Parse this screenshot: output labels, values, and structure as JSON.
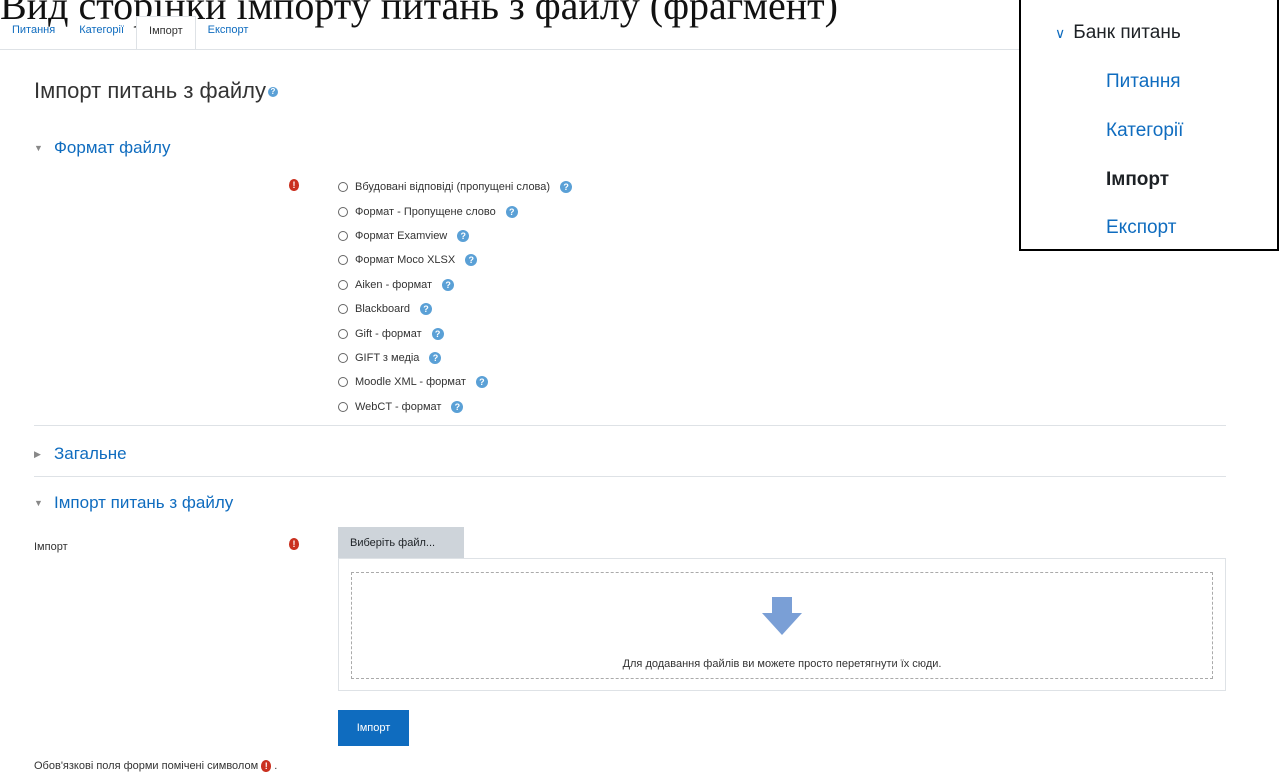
{
  "caption": "Вид сторінки імпорту питань з файлу (фрагмент)",
  "tabs": [
    {
      "label": "Питання"
    },
    {
      "label": "Категорії"
    },
    {
      "label": "Імпорт"
    },
    {
      "label": "Експорт"
    }
  ],
  "active_tab": "Імпорт",
  "page_title": "Імпорт питань з файлу",
  "sections": {
    "format": "Формат файлу",
    "general": "Загальне",
    "import_file": "Імпорт питань з файлу"
  },
  "formats": [
    "Вбудовані відповіді (пропущені слова)",
    "Формат - Пропущене слово",
    "Формат Examview",
    "Формат Moco XLSX",
    "Aiken - формат",
    "Blackboard",
    "Gift - формат",
    "GIFT з медіа",
    "Moodle XML - формат",
    "WebCT - формат"
  ],
  "import_field_label": "Імпорт",
  "choose_file_button": "Виберіть файл...",
  "drop_hint": "Для додавання файлів ви можете просто перетягнути їх сюди.",
  "import_button": "Імпорт",
  "required_note": "Обов'язкові поля форми помічені символом",
  "question_bank_menu": {
    "title": "Банк питань",
    "items": [
      "Питання",
      "Категорії",
      "Імпорт",
      "Експорт"
    ],
    "active": "Імпорт"
  },
  "colors": {
    "link": "#0f6cbf",
    "required": "#ca3120",
    "help": "#5aa0d6",
    "primary_button": "#0f6cbf"
  },
  "icons": {
    "help": "question-circle-icon",
    "required": "exclamation-circle-icon",
    "expanded": "caret-down-icon",
    "collapsed": "caret-right-icon",
    "upload": "arrow-down-icon",
    "menu": "chevron-down-icon"
  }
}
